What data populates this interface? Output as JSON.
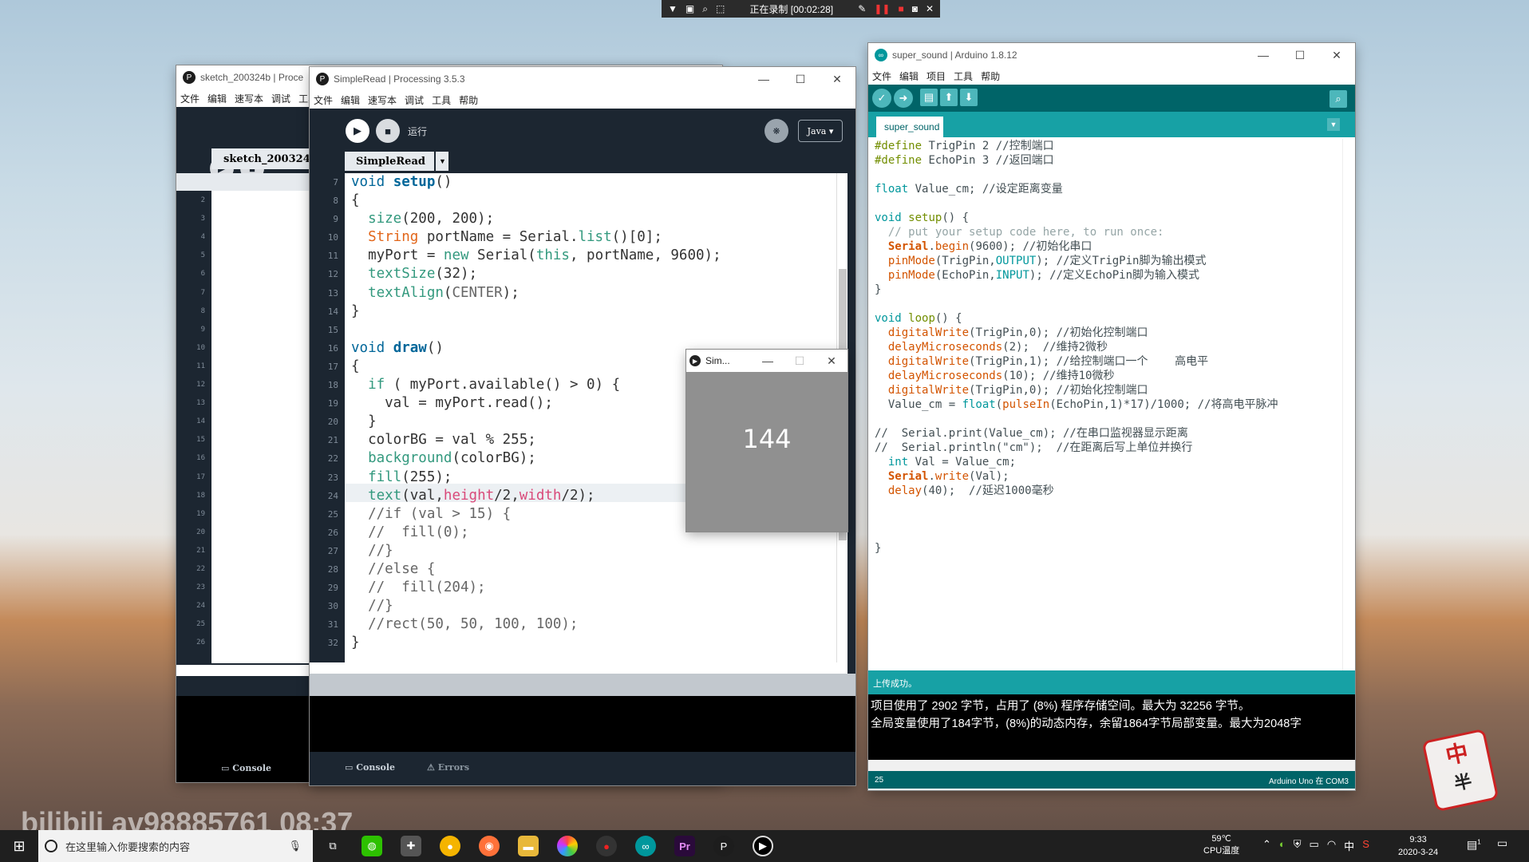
{
  "recording_bar": {
    "status": "正在录制 [00:02:28]"
  },
  "win_sketch": {
    "title": "sketch_200324b | Proce",
    "menu": [
      "文件",
      "编辑",
      "速写本",
      "调试",
      "工具"
    ],
    "tab": "sketch_200324b",
    "lines": [
      "1",
      "2",
      "3",
      "4",
      "5",
      "6",
      "7",
      "8",
      "9",
      "10",
      "11",
      "12",
      "13",
      "14",
      "15",
      "16",
      "17",
      "18",
      "19",
      "20",
      "21",
      "22",
      "23",
      "24",
      "25",
      "26"
    ],
    "console": "Console"
  },
  "win_processing": {
    "title": "SimpleRead | Processing 3.5.3",
    "menu": [
      "文件",
      "编辑",
      "速写本",
      "调试",
      "工具",
      "帮助"
    ],
    "run_label": "运行",
    "mode": "Java ▾",
    "tab": "SimpleRead",
    "line_numbers": [
      "7",
      "8",
      "9",
      "10",
      "11",
      "12",
      "13",
      "14",
      "15",
      "16",
      "17",
      "18",
      "19",
      "20",
      "21",
      "22",
      "23",
      "24",
      "25",
      "26",
      "27",
      "28",
      "29",
      "30",
      "31",
      "32"
    ],
    "console_tab": "Console",
    "errors_tab": "Errors"
  },
  "sketch_window": {
    "title": "Sim...",
    "value": "144"
  },
  "win_arduino": {
    "title": "super_sound | Arduino 1.8.12",
    "menu": [
      "文件",
      "编辑",
      "项目",
      "工具",
      "帮助"
    ],
    "tab": "super_sound",
    "status": "上传成功。",
    "output": [
      "项目使用了 2902 字节，占用了 (8%) 程序存储空间。最大为 32256 字节。",
      "全局变量使用了184字节，(8%)的动态内存，余留1864字节局部变量。最大为2048字"
    ],
    "footer_line": "25",
    "footer_board": "Arduino Uno 在 COM3"
  },
  "watermark": "bilibili av98885761 08:37",
  "taskbar": {
    "search_placeholder": "在这里输入你要搜索的内容",
    "temp": "59℃",
    "temp_label": "CPU温度",
    "ime": "中",
    "time": "9:33",
    "date": "2020-3-24",
    "notif_count": "1"
  },
  "mascot": {
    "line1": "中",
    "line2": "半"
  }
}
